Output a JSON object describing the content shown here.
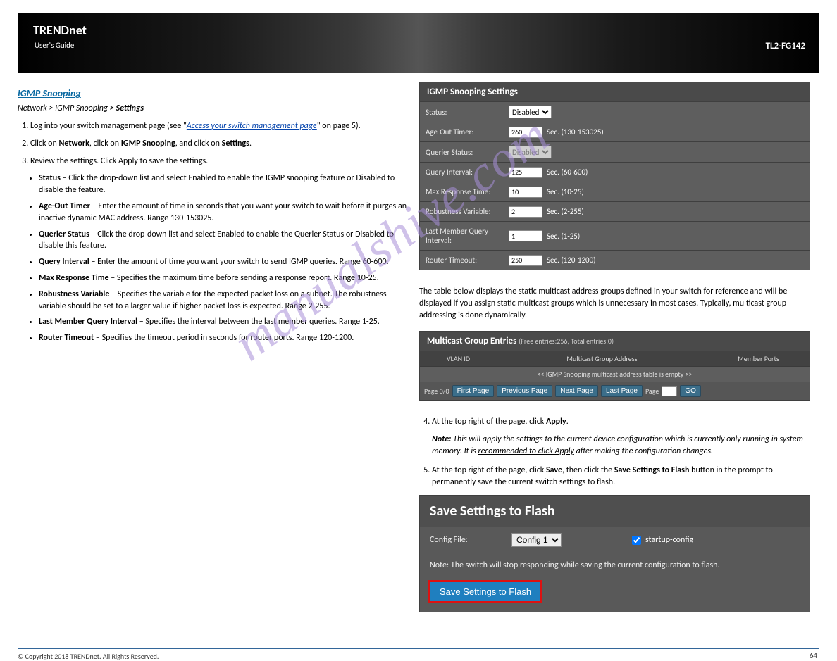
{
  "header": {
    "brand": "TRENDnet",
    "tagline": "User's Guide",
    "model": "TL2-FG142"
  },
  "left": {
    "section_title": "IGMP Snooping",
    "nav_path_prefix": "Network > IGMP Snooping ",
    "explain_heading": "Settings",
    "step1_a": "Log into your switch management page (see \"",
    "step1_link": "Access your switch management page",
    "step1_b": "\" on page 5).",
    "step2_a": "Click on ",
    "step2_b1": "Network",
    "step2_c": ", click on ",
    "step2_b2": "IGMP Snooping",
    "step2_d": ", and click on ",
    "step2_b3": "Settings",
    "step2_e": ".",
    "step3": "Review the settings. Click Apply to save the settings.",
    "bullets": [
      {
        "label": "Status",
        "text": " – Click the drop-down list and select Enabled to enable the IGMP snooping feature or Disabled to disable the feature."
      },
      {
        "label": "Age-Out Timer",
        "text": " – Enter the amount of time in seconds that you want your switch to wait before it purges an inactive dynamic MAC address. Range 130-153025."
      },
      {
        "label": "Querier Status",
        "text": " – Click the drop-down list and select Enabled to enable the Querier Status or Disabled to disable this feature."
      },
      {
        "label": "Query Interval",
        "text": " – Enter the amount of time you want your switch to send IGMP queries. Range 60-600."
      },
      {
        "label": "Max Response Time",
        "text": " – Specifies the maximum time before sending a response report. Range 10-25."
      },
      {
        "label": "Robustness Variable",
        "text": " – Specifies the variable for the expected packet loss on a subnet. The robustness variable should be set to a larger value if higher packet loss is expected. Range 2-255."
      },
      {
        "label": "Last Member Query Interval",
        "text": " – Specifies the interval between the last member queries. Range 1-25."
      },
      {
        "label": "Router Timeout",
        "text": " – Specifies the timeout period in seconds for router ports. Range 120-1200."
      }
    ],
    "below_text": "The table below displays the static multicast address groups defined in your switch for reference and will be displayed if you assign static multicast groups which is unnecessary in most cases. Typically, multicast group addressing is done dynamically.",
    "step4_a": "At the top right of the page, click ",
    "step4_b": "Apply",
    "step4_c": ".",
    "note_label": "Note:",
    "note_text": " This will apply the settings to the current device configuration which is currently only running in system memory. It is ",
    "note_under": "recommended to click Apply",
    "note_text2": " after making the configuration changes.",
    "step5_a": "At the top right of the page, click ",
    "step5_b": "Save",
    "step5_c": ", then click the ",
    "step5_d": "Save Settings to Flash",
    "step5_e": " button in the prompt to permanently save the current switch settings to flash."
  },
  "igmp": {
    "title": "IGMP Snooping Settings",
    "rows": {
      "status": {
        "label": "Status:",
        "value": "Disabled"
      },
      "age": {
        "label": "Age-Out Timer:",
        "value": "260",
        "hint": "Sec. (130-153025)"
      },
      "querier": {
        "label": "Querier Status:",
        "value": "Disabled"
      },
      "qint": {
        "label": "Query Interval:",
        "value": "125",
        "hint": "Sec. (60-600)"
      },
      "maxresp": {
        "label": "Max Response Time:",
        "value": "10",
        "hint": "Sec. (10-25)"
      },
      "robust": {
        "label": "Robustness Variable:",
        "value": "2",
        "hint": "Sec. (2-255)"
      },
      "lmqi": {
        "label": "Last Member Query Interval:",
        "value": "1",
        "hint": "Sec. (1-25)"
      },
      "rtimeout": {
        "label": "Router Timeout:",
        "value": "250",
        "hint": "Sec. (120-1200)"
      }
    }
  },
  "mcast": {
    "title": "Multicast Group Entries",
    "title_sub": "(Free entries:256, Total entries:0)",
    "cols": {
      "vlan": "VLAN ID",
      "mga": "Multicast Group Address",
      "mp": "Member Ports"
    },
    "empty": "<< IGMP Snooping multicast address table is empty >>",
    "pager": {
      "page_of": "Page 0/0",
      "first": "First Page",
      "prev": "Previous Page",
      "next": "Next Page",
      "last": "Last Page",
      "page_lbl": "Page",
      "go": "GO"
    }
  },
  "save": {
    "title": "Save Settings to Flash",
    "config_label": "Config File:",
    "config_value": "Config 1",
    "startup_label": "startup-config",
    "note": "Note: The switch will stop responding while saving the current configuration to flash.",
    "button": "Save Settings to Flash"
  },
  "footer": {
    "copyright": "© Copyright 2018 TRENDnet. All Rights Reserved.",
    "page_number": "64"
  },
  "watermark": "manualshive.com"
}
